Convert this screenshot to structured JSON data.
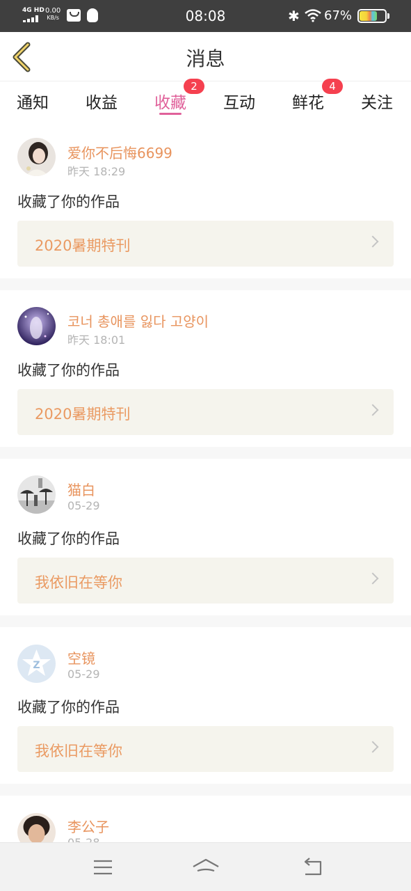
{
  "status": {
    "network": "4G HD",
    "speed_value": "0.00",
    "speed_unit": "KB/s",
    "time": "08:08",
    "battery": "67%",
    "battery_level": 0.67,
    "icons": [
      "signal-icon",
      "mail-icon",
      "qq-icon",
      "bluetooth-icon",
      "wifi-icon",
      "battery-icon"
    ]
  },
  "header": {
    "title": "消息",
    "back_icon": "chevron-left-icon"
  },
  "tabs": [
    {
      "label": "通知",
      "badge": ""
    },
    {
      "label": "收益",
      "badge": ""
    },
    {
      "label": "收藏",
      "badge": "2",
      "active": true
    },
    {
      "label": "互动",
      "badge": ""
    },
    {
      "label": "鲜花",
      "badge": "4"
    },
    {
      "label": "关注",
      "badge": ""
    }
  ],
  "colors": {
    "accent": "#e0619a",
    "badge": "#f5404f",
    "username": "#e8945e",
    "work_bg": "#f5f4ed"
  },
  "messages": [
    {
      "user": "爱你不后悔6699",
      "time": "昨天 18:29",
      "action": "收藏了你的作品",
      "work": "2020暑期特刊"
    },
    {
      "user": "코너 총애를 잃다 고양이",
      "time": "昨天 18:01",
      "action": "收藏了你的作品",
      "work": "2020暑期特刊"
    },
    {
      "user": "猫白",
      "time": "05-29",
      "action": "收藏了你的作品",
      "work": "我依旧在等你"
    },
    {
      "user": "空镜",
      "time": "05-29",
      "action": "收藏了你的作品",
      "work": "我依旧在等你"
    },
    {
      "user": "李公子",
      "time": "05-28",
      "action": "",
      "work": ""
    }
  ],
  "navbar": {
    "icons": [
      "menu-icon",
      "home-icon",
      "back-icon"
    ]
  }
}
